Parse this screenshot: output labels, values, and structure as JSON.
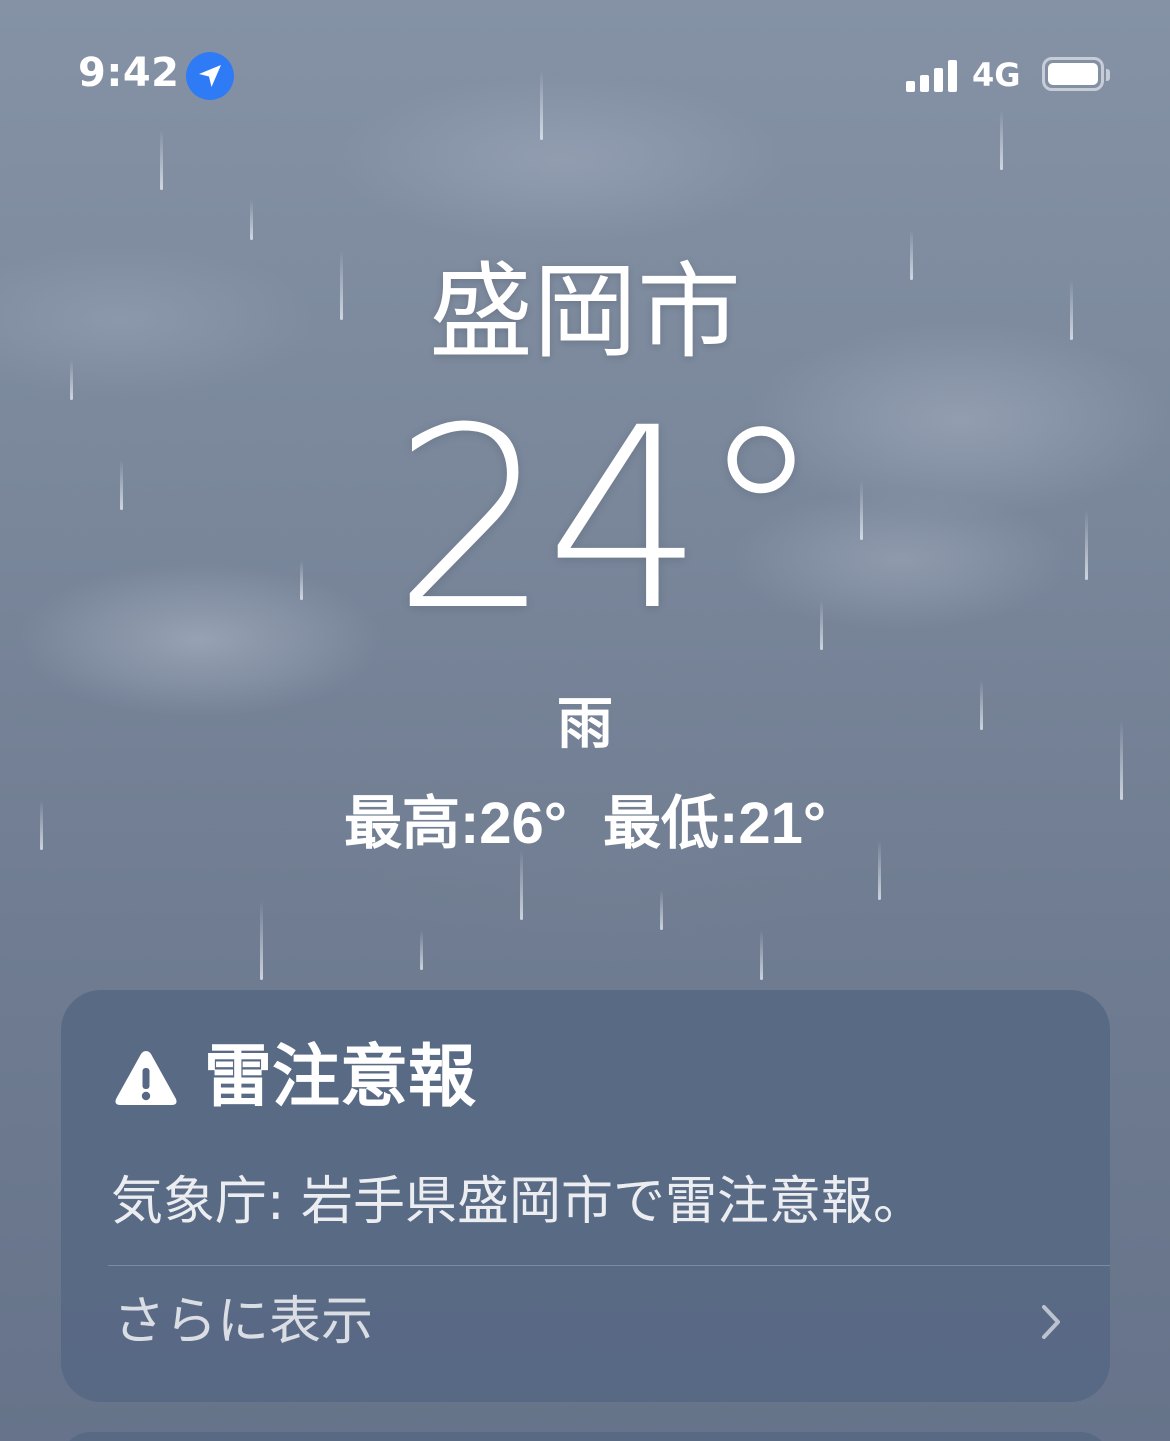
{
  "status_bar": {
    "time": "9:42",
    "network": "4G",
    "icons": [
      "location-arrow-icon",
      "cellular-signal-icon",
      "battery-icon"
    ]
  },
  "weather": {
    "city": "盛岡市",
    "temperature": "24°",
    "condition": "雨",
    "high": "最高:26°",
    "low": "最低:21°"
  },
  "alert": {
    "icon": "warning-triangle-icon",
    "title": "雷注意報",
    "body": "気象庁: 岩手県盛岡市で雷注意報。",
    "more_label": "さらに表示",
    "chevron_icon": "chevron-right-icon"
  },
  "colors": {
    "background_top": "#8592a6",
    "background_bottom": "#66738a",
    "card": "#566884",
    "location_blue": "#2f7bf5",
    "text": "#ffffff"
  }
}
